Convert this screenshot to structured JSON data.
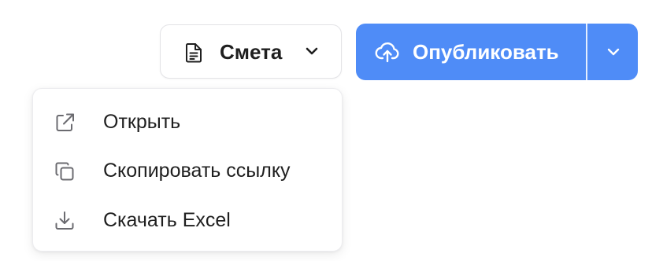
{
  "document_button": {
    "label": "Смета",
    "icon": "document-icon",
    "chevron_icon": "chevron-down-icon"
  },
  "publish": {
    "label": "Опубликовать",
    "icon": "cloud-upload-icon",
    "toggle_icon": "chevron-down-icon",
    "color": "#4f8cf7"
  },
  "menu": {
    "items": [
      {
        "label": "Открыть",
        "icon": "external-link-icon"
      },
      {
        "label": "Скопировать ссылку",
        "icon": "copy-icon"
      },
      {
        "label": "Скачать Excel",
        "icon": "download-icon"
      }
    ]
  }
}
